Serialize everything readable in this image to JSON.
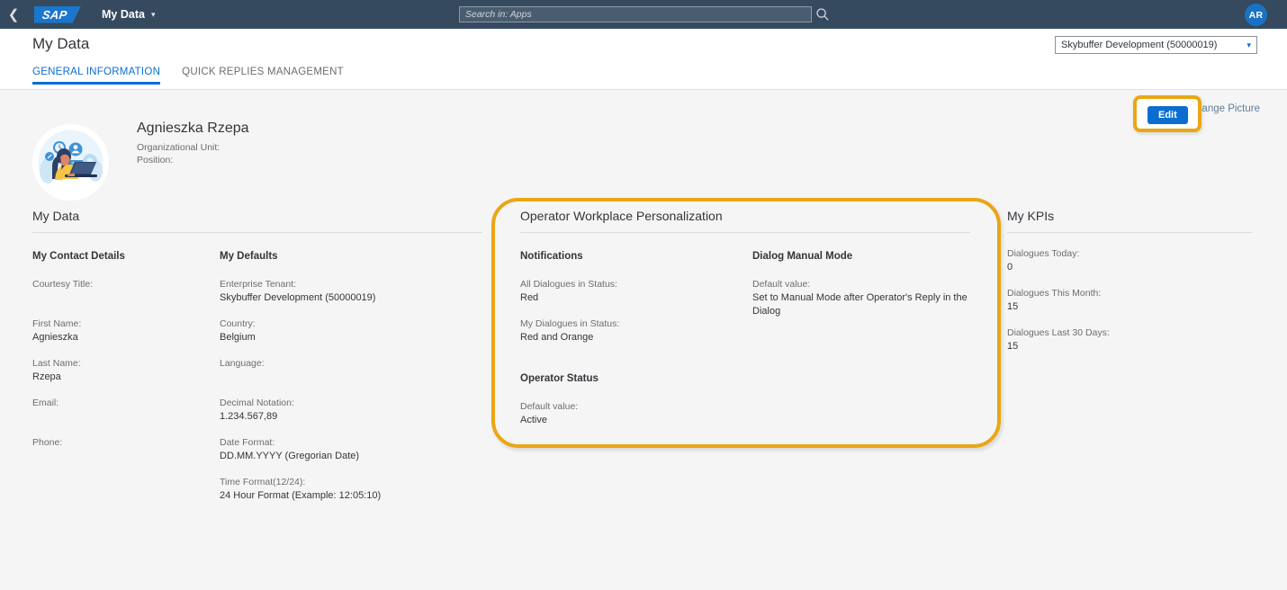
{
  "shell": {
    "back_icon": "chevron-left-icon",
    "logo_text": "SAP",
    "app_title": "My Data",
    "app_title_caret": "⌄",
    "search_placeholder": "Search in: Apps",
    "search_value": "",
    "search_icon": "search-icon",
    "avatar_initials": "AR"
  },
  "page": {
    "title": "My Data",
    "tenant_selected": "Skybuffer Development (50000019)",
    "tenant_caret": "∨",
    "tabs": [
      {
        "label": "GENERAL INFORMATION",
        "active": true
      },
      {
        "label": "QUICK REPLIES MANAGEMENT",
        "active": false
      }
    ]
  },
  "profile": {
    "avatar_icon": "operator-illustration-avatar",
    "name": "Agnieszka Rzepa",
    "org_unit_label": "Organizational Unit:",
    "position_label": "Position:",
    "edit_label": "Edit",
    "change_picture_label": "Change Picture"
  },
  "my_data": {
    "title": "My Data",
    "contact_details": {
      "heading": "My Contact Details",
      "fields": [
        {
          "label": "Courtesy Title:",
          "value": ""
        },
        {
          "label": "First Name:",
          "value": "Agnieszka"
        },
        {
          "label": "Last Name:",
          "value": "Rzepa"
        },
        {
          "label": "Email:",
          "value": ""
        },
        {
          "label": "Phone:",
          "value": ""
        }
      ]
    },
    "defaults": {
      "heading": "My Defaults",
      "fields": [
        {
          "label": "Enterprise Tenant:",
          "value": "Skybuffer Development (50000019)"
        },
        {
          "label": "Country:",
          "value": "Belgium"
        },
        {
          "label": "Language:",
          "value": ""
        },
        {
          "label": "Decimal Notation:",
          "value": "1.234.567,89"
        },
        {
          "label": "Date Format:",
          "value": "DD.MM.YYYY (Gregorian Date)"
        },
        {
          "label": "Time Format(12/24):",
          "value": "24 Hour Format (Example: 12:05:10)"
        }
      ]
    }
  },
  "operator": {
    "title": "Operator Workplace Personalization",
    "notifications": {
      "heading": "Notifications",
      "fields": [
        {
          "label": "All Dialogues in Status:",
          "value": "Red"
        },
        {
          "label": "My Dialogues in Status:",
          "value": "Red and Orange"
        }
      ]
    },
    "operator_status": {
      "heading": "Operator Status",
      "fields": [
        {
          "label": "Default value:",
          "value": "Active"
        }
      ]
    },
    "dialog_manual_mode": {
      "heading": "Dialog Manual Mode",
      "fields": [
        {
          "label": "Default value:",
          "value": "Set to Manual Mode after Operator's Reply in the Dialog"
        }
      ]
    }
  },
  "kpis": {
    "title": "My KPIs",
    "items": [
      {
        "label": "Dialogues Today:",
        "value": "0"
      },
      {
        "label": "Dialogues This Month:",
        "value": "15"
      },
      {
        "label": "Dialogues Last 30 Days:",
        "value": "15"
      }
    ]
  },
  "colors": {
    "shell_bar": "#354a5f",
    "accent_blue": "#0a6ed1",
    "highlight_orange": "#eaa615",
    "page_bg": "#f5f5f5"
  }
}
